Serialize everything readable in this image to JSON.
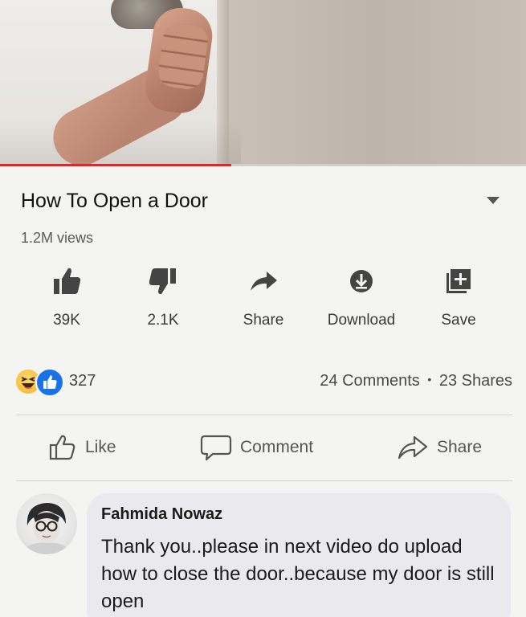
{
  "video": {
    "title": "How To Open a Door",
    "views": "1.2M views",
    "progress_fraction": 0.44
  },
  "actions": [
    {
      "name": "like",
      "label": "39K",
      "icon": "thumbs-up-icon"
    },
    {
      "name": "dislike",
      "label": "2.1K",
      "icon": "thumbs-down-icon"
    },
    {
      "name": "share",
      "label": "Share",
      "icon": "share-arrow-icon"
    },
    {
      "name": "download",
      "label": "Download",
      "icon": "download-icon"
    },
    {
      "name": "save",
      "label": "Save",
      "icon": "add-to-playlist-icon"
    }
  ],
  "post": {
    "reaction_count": "327",
    "comments": "24 Comments",
    "separator": "•",
    "shares": "23 Shares",
    "buttons": {
      "like": "Like",
      "comment": "Comment",
      "share": "Share"
    }
  },
  "comment": {
    "author": "Fahmida Nowaz",
    "text": "Thank you..please in next video do upload how to close the door..because my door is still open"
  },
  "colors": {
    "progress": "#e0262b",
    "like_reaction": "#1a72e8",
    "haha_reaction": "#f3b624"
  }
}
